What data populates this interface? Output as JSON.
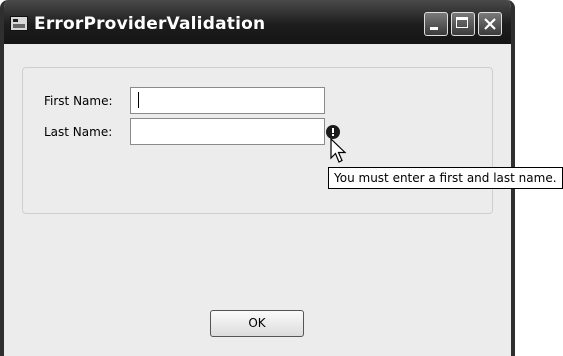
{
  "window": {
    "title": "ErrorProviderValidation"
  },
  "form": {
    "first_name_label": "First Name:",
    "first_name_value": "",
    "last_name_label": "Last Name:",
    "last_name_value": ""
  },
  "error": {
    "icon": "error-icon",
    "tooltip": "You must enter a first and last name."
  },
  "buttons": {
    "ok_label": "OK"
  },
  "icons": {
    "app": "app-window-icon",
    "minimize": "minimize-icon",
    "maximize": "maximize-icon",
    "close": "close-icon",
    "cursor": "mouse-pointer-icon"
  }
}
